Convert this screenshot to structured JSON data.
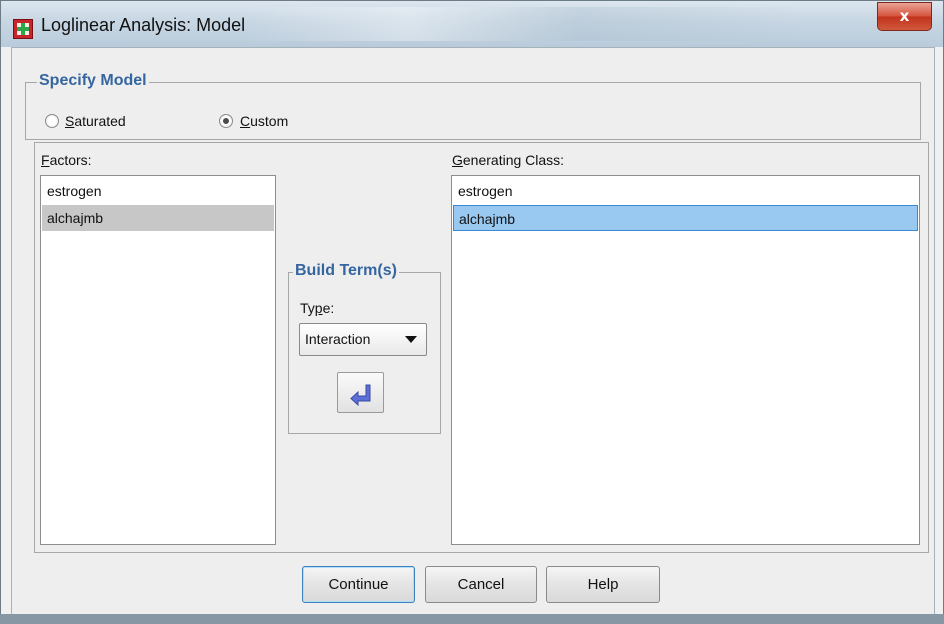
{
  "window": {
    "title": "Loglinear Analysis: Model",
    "close_label": "x"
  },
  "specify_model": {
    "legend": "Specify Model",
    "saturated_label": "Saturated",
    "custom_label": "Custom",
    "selected": "Custom"
  },
  "factors": {
    "label": "Factors:",
    "items": [
      "estrogen",
      "alchajmb"
    ],
    "selected_index": 1
  },
  "build_terms": {
    "legend": "Build Term(s)",
    "type_label": "Type:",
    "type_value": "Interaction"
  },
  "generating_class": {
    "label": "Generating Class:",
    "items": [
      "estrogen",
      "alchajmb"
    ],
    "selected_index": 1
  },
  "buttons": {
    "continue": "Continue",
    "cancel": "Cancel",
    "help": "Help"
  },
  "colors": {
    "legend_text": "#36669f",
    "selected_gray": "#c7c7c7",
    "selected_blue": "#99c9f0",
    "close_red": "#c2331d"
  },
  "icons": {
    "app": "spss-table-icon",
    "transfer": "transfer-arrow-icon"
  }
}
